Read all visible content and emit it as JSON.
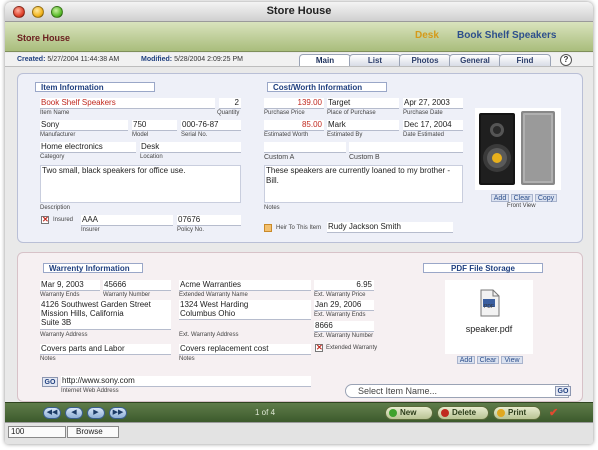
{
  "window": {
    "title": "Store House"
  },
  "header": {
    "store_name": "Store House",
    "location": "Desk",
    "item_title": "Book Shelf Speakers"
  },
  "meta": {
    "created_label": "Created:",
    "created_value": "5/27/2004 11:44:38 AM",
    "modified_label": "Modified:",
    "modified_value": "5/28/2004 2:09:25 PM"
  },
  "tabs": [
    {
      "label": "Main"
    },
    {
      "label": "List"
    },
    {
      "label": "Photos"
    },
    {
      "label": "General"
    },
    {
      "label": "Find"
    }
  ],
  "help_label": "?",
  "item_info": {
    "title": "Item Information",
    "name": "Book Shelf Speakers",
    "name_label": "Item Name",
    "quantity": "2",
    "quantity_label": "Quantity",
    "manufacturer": "Sony",
    "manufacturer_label": "Manufacturer",
    "model": "750",
    "model_label": "Model",
    "serial": "000-76-87",
    "serial_label": "Serial No.",
    "category": "Home electronics",
    "category_label": "Category",
    "location": "Desk",
    "location_label": "Location",
    "description": "Two small, black speakers for office use.",
    "description_label": "Description",
    "insured_label": "Insured",
    "insurer": "AAA",
    "insurer_label": "Insurer",
    "policy": "07676",
    "policy_label": "Policy No."
  },
  "cost_info": {
    "title": "Cost/Worth Information",
    "purchase_price": "139.00",
    "purchase_price_label": "Purchase Price",
    "place": "Target",
    "place_label": "Place of Purchase",
    "purchase_date": "Apr 27, 2003",
    "purchase_date_label": "Purchase Date",
    "worth": "85.00",
    "worth_label": "Estimated Worth",
    "estimated_by": "Mark",
    "estimated_by_label": "Estimated By",
    "date_estimated": "Dec 17, 2004",
    "date_estimated_label": "Date Estimated",
    "custom_a_label": "Custom A",
    "custom_b_label": "Custom B",
    "notes": "These speakers are currently loaned to my brother - Bill.",
    "notes_label": "Notes",
    "heir_label": "Heir To This Item",
    "heir": "Rudy Jackson Smith"
  },
  "front_view": {
    "add": "Add",
    "clear": "Clear",
    "copy": "Copy",
    "caption": "Front View"
  },
  "warranty": {
    "title": "Warrenty Information",
    "ends": "Mar 9, 2003",
    "ends_label": "Warranty Ends",
    "number": "45666",
    "number_label": "Warranty Number",
    "address": "4126 Southwest Garden Street\nMission Hills, California\nSuite 3B",
    "address_label": "Warranty Address",
    "notes": "Covers parts and Labor",
    "notes_label": "Notes",
    "ext_name": "Acme Warranties",
    "ext_name_label": "Extended Warranty Name",
    "ext_price": "6.95",
    "ext_price_label": "Ext. Warranty Price",
    "ext_address": "1324 West Harding\nColumbus Ohio",
    "ext_address_label": "Ext. Warranty Address",
    "ext_ends": "Jan 29, 2006",
    "ext_ends_label": "Ext. Warranty Ends",
    "ext_number": "8666",
    "ext_number_label": "Ext. Warranty Number",
    "ext_notes": "Covers replacement cost",
    "ext_notes_label": "Notes",
    "extended_label": "Extended Warranty",
    "go": "GO",
    "web": "http://www.sony.com",
    "web_label": "Internet Web Address"
  },
  "pdf": {
    "title": "PDF File Storage",
    "icon_label": "PDF",
    "filename": "speaker.pdf",
    "add": "Add",
    "clear": "Clear",
    "view": "View"
  },
  "select_item": {
    "placeholder": "Select Item Name...",
    "go": "GO"
  },
  "toolbar": {
    "first": "◀◀",
    "prev": "◀",
    "next": "▶",
    "last": "▶▶",
    "record_count": "1 of 4",
    "new": "New",
    "delete": "Delete",
    "print": "Print"
  },
  "status": {
    "zoom": "100",
    "mode": "Browse"
  },
  "colors": {
    "accent_red": "#c0291f",
    "accent_blue": "#1f3f7f",
    "header_green": "#a9bd7c",
    "location_gold": "#d59a1a"
  },
  "icons": [
    "close-icon",
    "minimize-icon",
    "zoom-icon",
    "help-icon",
    "checkbox-checked-icon",
    "speaker-photo",
    "pdf-file-icon",
    "first-record-icon",
    "prev-record-icon",
    "next-record-icon",
    "last-record-icon",
    "new-plus-icon",
    "delete-x-icon",
    "print-icon",
    "checkmark-icon"
  ]
}
